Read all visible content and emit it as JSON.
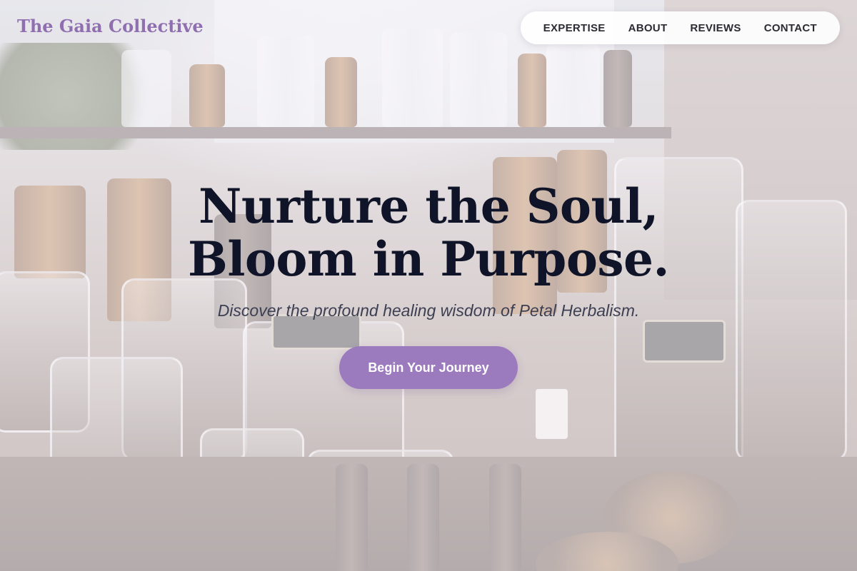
{
  "brand": {
    "name": "The Gaia Collective"
  },
  "nav": {
    "items": [
      {
        "label": "EXPERTISE"
      },
      {
        "label": "ABOUT"
      },
      {
        "label": "REVIEWS"
      },
      {
        "label": "CONTACT"
      }
    ]
  },
  "hero": {
    "title": "Nurture the Soul, Bloom in Purpose.",
    "subtitle": "Discover the profound healing wisdom of Petal Herbalism.",
    "cta_label": "Begin Your Journey"
  },
  "colors": {
    "accent": "#9b7bbd",
    "logo": "#8f6fb0",
    "heading": "#0f1428",
    "overlay": "#f6f2f8"
  },
  "background": {
    "image_subject": "apothecary-jars-and-herbs"
  }
}
